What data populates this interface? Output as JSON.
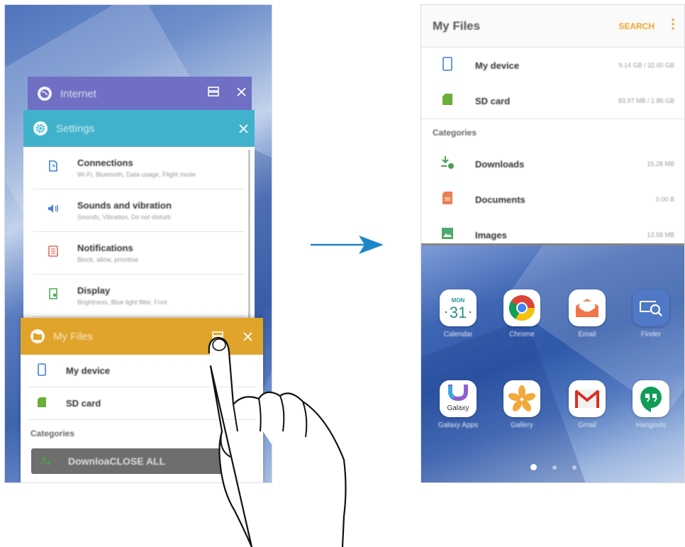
{
  "left_screen": {
    "cards": {
      "internet": {
        "title": "Internet",
        "color": "#6f6fc4",
        "icon": "globe-icon"
      },
      "settings": {
        "title": "Settings",
        "color": "#41b2cb",
        "icon": "gear-icon",
        "items": [
          {
            "title": "Connections",
            "subtitle": "Wi-Fi, Bluetooth, Data usage, Flight mode",
            "icon": "connections-icon",
            "color": "#3d7fd8"
          },
          {
            "title": "Sounds and vibration",
            "subtitle": "Sounds, Vibration, Do not disturb",
            "icon": "sound-icon",
            "color": "#4a7fd0"
          },
          {
            "title": "Notifications",
            "subtitle": "Block, allow, prioritise",
            "icon": "notifications-icon",
            "color": "#e36a5f"
          },
          {
            "title": "Display",
            "subtitle": "Brightness, Blue light filter, Font",
            "icon": "display-icon",
            "color": "#4cae55"
          }
        ]
      },
      "my_files": {
        "title": "My Files",
        "color": "#e0a42a",
        "icon": "folder-icon",
        "items": [
          {
            "label": "My device",
            "icon": "phone-icon"
          },
          {
            "label": "SD card",
            "icon": "sd-card-icon"
          }
        ],
        "category_header": "Categories",
        "downloads_label": "Downloa",
        "close_all_label": "CLOSE ALL"
      }
    }
  },
  "right_screen": {
    "my_files": {
      "title": "My Files",
      "search_label": "SEARCH",
      "storage": [
        {
          "label": "My device",
          "size": "9.14 GB / 32.00 GB",
          "icon": "phone-icon"
        },
        {
          "label": "SD card",
          "size": "83.97 MB / 1.86 GB",
          "icon": "sd-card-icon"
        }
      ],
      "category_header": "Categories",
      "categories": [
        {
          "label": "Downloads",
          "size": "15.28 MB",
          "icon": "download-icon"
        },
        {
          "label": "Documents",
          "size": "0.00 B",
          "icon": "document-icon"
        },
        {
          "label": "Images",
          "size": "13.58 MB",
          "icon": "image-icon"
        }
      ]
    },
    "home": {
      "apps": [
        {
          "label": "Calendar",
          "icon": "calendar-icon",
          "weekday": "MON",
          "day": "31"
        },
        {
          "label": "Chrome",
          "icon": "chrome-icon"
        },
        {
          "label": "Email",
          "icon": "email-icon"
        },
        {
          "label": "Finder",
          "icon": "finder-icon"
        },
        {
          "label": "Galaxy Apps",
          "icon": "galaxy-apps-icon",
          "badge": "Galaxy"
        },
        {
          "label": "Gallery",
          "icon": "gallery-icon"
        },
        {
          "label": "Gmail",
          "icon": "gmail-icon"
        },
        {
          "label": "Hangouts",
          "icon": "hangouts-icon"
        }
      ],
      "pages": 3,
      "active_page": 1
    }
  }
}
